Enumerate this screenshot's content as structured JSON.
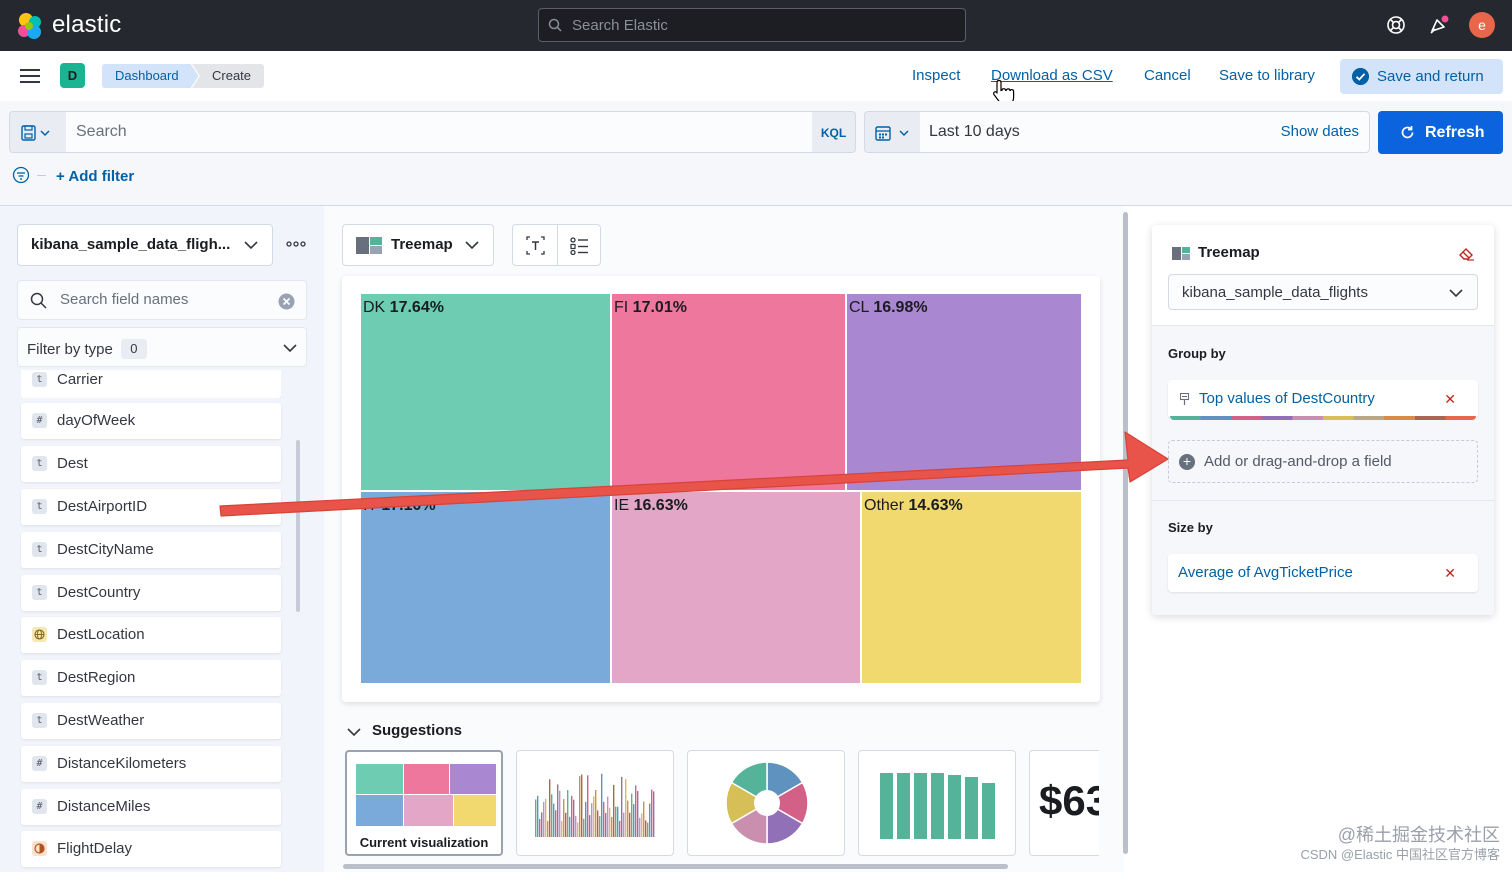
{
  "header": {
    "brand": "elastic",
    "search_placeholder": "Search Elastic",
    "user_initial": "e"
  },
  "nav": {
    "space_initial": "D",
    "breadcrumbs": [
      "Dashboard",
      "Create"
    ],
    "links": [
      "Inspect",
      "Download as CSV",
      "Cancel",
      "Save to library"
    ],
    "save_and_return": "Save and return"
  },
  "query": {
    "placeholder": "Search",
    "language": "KQL",
    "date_range": "Last 10 days",
    "show_dates": "Show dates",
    "refresh": "Refresh",
    "add_filter": "+ Add filter"
  },
  "fields_panel": {
    "index_pattern": "kibana_sample_data_fligh...",
    "search_placeholder": "Search field names",
    "filter_by_type": "Filter by type",
    "filter_count": "0",
    "fields": [
      {
        "name": "Carrier",
        "type": "t"
      },
      {
        "name": "dayOfWeek",
        "type": "#"
      },
      {
        "name": "Dest",
        "type": "t"
      },
      {
        "name": "DestAirportID",
        "type": "t"
      },
      {
        "name": "DestCityName",
        "type": "t"
      },
      {
        "name": "DestCountry",
        "type": "t"
      },
      {
        "name": "DestLocation",
        "type": "geo"
      },
      {
        "name": "DestRegion",
        "type": "t"
      },
      {
        "name": "DestWeather",
        "type": "t"
      },
      {
        "name": "DistanceKilometers",
        "type": "#"
      },
      {
        "name": "DistanceMiles",
        "type": "#"
      },
      {
        "name": "FlightDelay",
        "type": "bool"
      }
    ]
  },
  "workspace": {
    "viz_type": "Treemap",
    "suggestions_title": "Suggestions",
    "suggestions": [
      {
        "label": "Current visualization",
        "kind": "treemap"
      },
      {
        "label": "",
        "kind": "bar-dense"
      },
      {
        "label": "",
        "kind": "donut"
      },
      {
        "label": "",
        "kind": "bar"
      },
      {
        "label": "",
        "kind": "metric",
        "text": "$63"
      }
    ]
  },
  "chart_data": {
    "type": "treemap",
    "cells": [
      {
        "label": "DK",
        "value": 17.64,
        "color": "#6dccb1"
      },
      {
        "label": "FI",
        "value": 17.01,
        "color": "#ee789d"
      },
      {
        "label": "CL",
        "value": 16.98,
        "color": "#a987d1"
      },
      {
        "label": "IT",
        "value": 17.1,
        "color": "#79aad9"
      },
      {
        "label": "IE",
        "value": 16.63,
        "color": "#e4a6c7"
      },
      {
        "label": "Other",
        "value": 14.63,
        "color": "#f1d86f"
      }
    ],
    "value_suffix": "%"
  },
  "config_panel": {
    "title": "Treemap",
    "layer_index": "kibana_sample_data_flights",
    "group_by_label": "Group by",
    "group_by_value": "Top values of DestCountry",
    "add_field": "Add or drag-and-drop a field",
    "size_by_label": "Size by",
    "size_by_value": "Average of AvgTicketPrice"
  },
  "watermark": {
    "line1": "@稀土掘金技术社区",
    "line2": "CSDN @Elastic 中国社区官方博客"
  },
  "colors": {
    "topbar": "#25282f",
    "primary": "#0b64dd",
    "link": "#0061a6",
    "arrow": "#e8544a"
  }
}
